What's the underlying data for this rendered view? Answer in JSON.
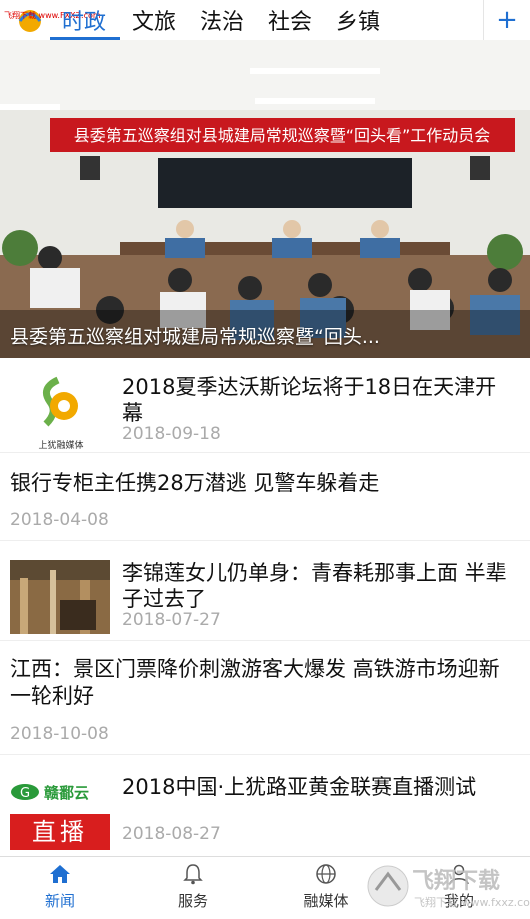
{
  "watermark_top": "飞翔下载 www.FXXZ.com",
  "tabs": [
    {
      "label": "时政",
      "active": true
    },
    {
      "label": "文旅",
      "active": false
    },
    {
      "label": "法治",
      "active": false
    },
    {
      "label": "社会",
      "active": false
    },
    {
      "label": "乡镇",
      "active": false
    }
  ],
  "add_label": "+",
  "hero": {
    "banner_text": "县委第五巡察组对县城建局常规巡察暨“回头看”工作动员会",
    "caption": "县委第五巡察组对城建局常规巡察暨“回头..."
  },
  "news": [
    {
      "title": "2018夏季达沃斯论坛将于18日在天津开幕",
      "date": "2018-09-18",
      "thumb_label": "上犹融媒体"
    },
    {
      "title": "银行专柜主任携28万潜逃 见警车躲着走",
      "date": "2018-04-08"
    },
    {
      "title": "李锦莲女儿仍单身：青春耗那事上面 半辈子过去了",
      "date": "2018-07-27"
    },
    {
      "title": "江西：景区门票降价刺激游客大爆发 高铁游市场迎新一轮利好",
      "date": "2018-10-08"
    },
    {
      "title": "2018中国·上犹路亚黄金联赛直播测试",
      "date": "2018-08-27",
      "thumb_top": "赣鄱云",
      "thumb_bottom": "直播"
    }
  ],
  "bottom_nav": [
    {
      "label": "新闻",
      "active": true
    },
    {
      "label": "服务",
      "active": false
    },
    {
      "label": "融媒体",
      "active": false
    },
    {
      "label": "我的",
      "active": false
    }
  ],
  "watermark_corner": "飞翔下载 www.fxxz.com",
  "colors": {
    "accent": "#1f6fd1",
    "banner_red": "#c8181e",
    "date_gray": "#aaaaaa"
  }
}
